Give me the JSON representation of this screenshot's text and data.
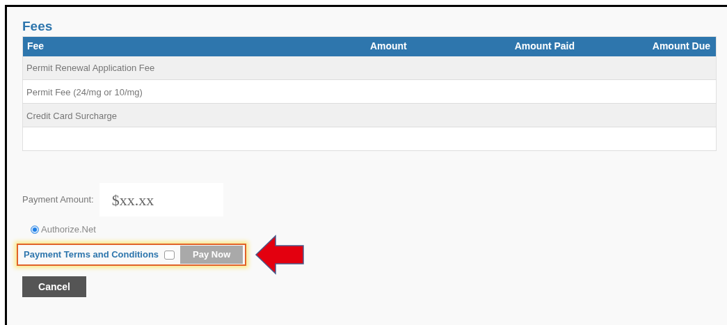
{
  "title": "Fees",
  "table": {
    "columns": [
      "Fee",
      "Amount",
      "Amount Paid",
      "Amount Due"
    ],
    "rows": [
      {
        "fee": "Permit Renewal Application Fee"
      },
      {
        "fee": "Permit Fee (24/mg or 10/mg)"
      },
      {
        "fee": "Credit Card Surcharge"
      },
      {}
    ]
  },
  "payment_amount": {
    "label": "Payment Amount:",
    "value": "$xx.xx"
  },
  "payment_methods": [
    {
      "label": "Authorize.Net",
      "selected": true
    }
  ],
  "terms": {
    "link": "Payment Terms and Conditions",
    "checked": false
  },
  "pay_button": {
    "label": "Pay Now",
    "disabled": true
  },
  "cancel_button": {
    "label": "Cancel"
  }
}
